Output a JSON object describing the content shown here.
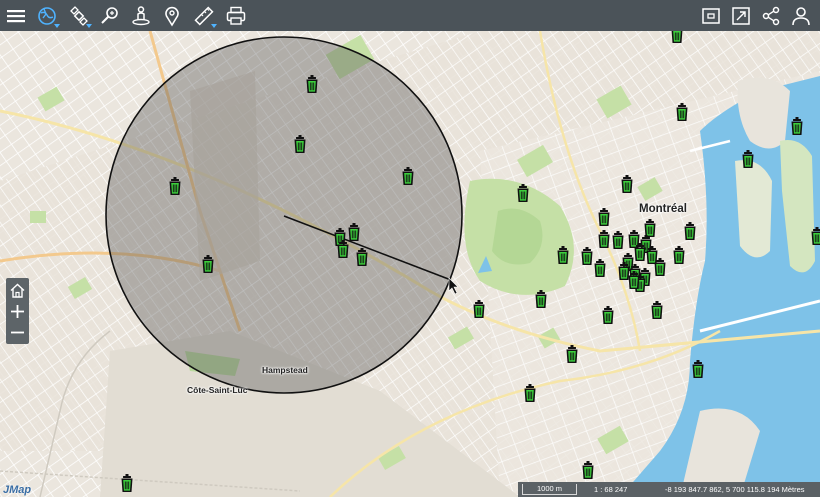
{
  "toolbar": {
    "left_tools": [
      {
        "name": "menu-icon"
      },
      {
        "name": "basemap-icon",
        "active": true
      },
      {
        "name": "satellite-icon"
      },
      {
        "name": "location-search-icon"
      },
      {
        "name": "street-view-icon"
      },
      {
        "name": "map-pin-icon"
      },
      {
        "name": "measure-icon"
      },
      {
        "name": "print-icon"
      }
    ],
    "right_tools": [
      {
        "name": "select-area-icon"
      },
      {
        "name": "fullscreen-icon"
      },
      {
        "name": "share-icon"
      },
      {
        "name": "user-icon"
      }
    ]
  },
  "map": {
    "labels": {
      "montreal": "Montréal",
      "hampstead": "Hampstead",
      "cote_saint_luc": "Côte-Saint-Luc"
    },
    "poi_icon": "trash-bin-icon",
    "poi_color": "#2db52d"
  },
  "zoom": {
    "home": "home-icon",
    "zoom_in": "plus-icon",
    "zoom_out": "minus-icon"
  },
  "logo": "JMap",
  "status": {
    "scale_bar": "1000 m",
    "scale_ratio": "1 : 68 247",
    "coordinates": "-8 193 847.7 862, 5 700 115.8 194 Mètres"
  },
  "colors": {
    "toolbar": "#4b5359",
    "water": "#7ec2e8",
    "park": "#c5e0a6",
    "selection_fill": "#555555",
    "accent": "#4fb3ff"
  }
}
